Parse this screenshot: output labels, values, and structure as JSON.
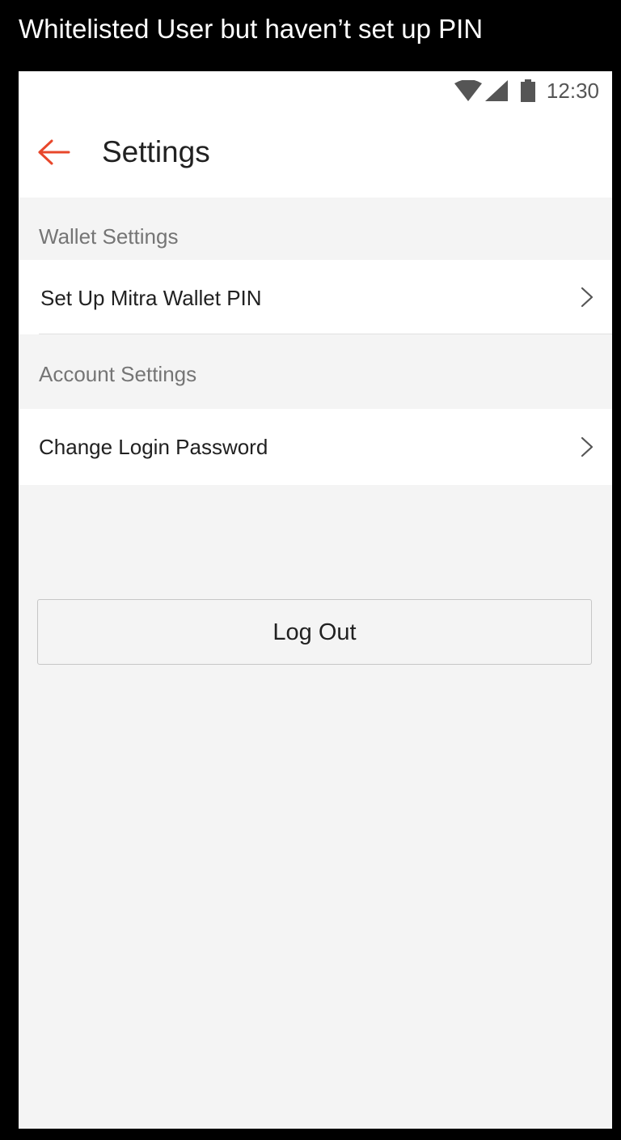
{
  "caption": "Whitelisted User but haven’t set up PIN",
  "status_bar": {
    "time": "12:30",
    "icons": [
      "wifi-icon",
      "signal-icon",
      "battery-icon"
    ]
  },
  "app_bar": {
    "back_icon": "arrow-left-icon",
    "title": "Settings"
  },
  "sections": [
    {
      "header": "Wallet Settings",
      "items": [
        {
          "label": "Set Up Mitra Wallet PIN",
          "icon": "chevron-right-icon"
        }
      ]
    },
    {
      "header": "Account Settings",
      "items": [
        {
          "label": "Change Login Password",
          "icon": "chevron-right-icon"
        }
      ]
    }
  ],
  "logout_label": "Log Out",
  "colors": {
    "accent": "#e8472b",
    "background": "#f4f4f4",
    "surface": "#ffffff",
    "text_primary": "#212121",
    "text_secondary": "#757575"
  }
}
